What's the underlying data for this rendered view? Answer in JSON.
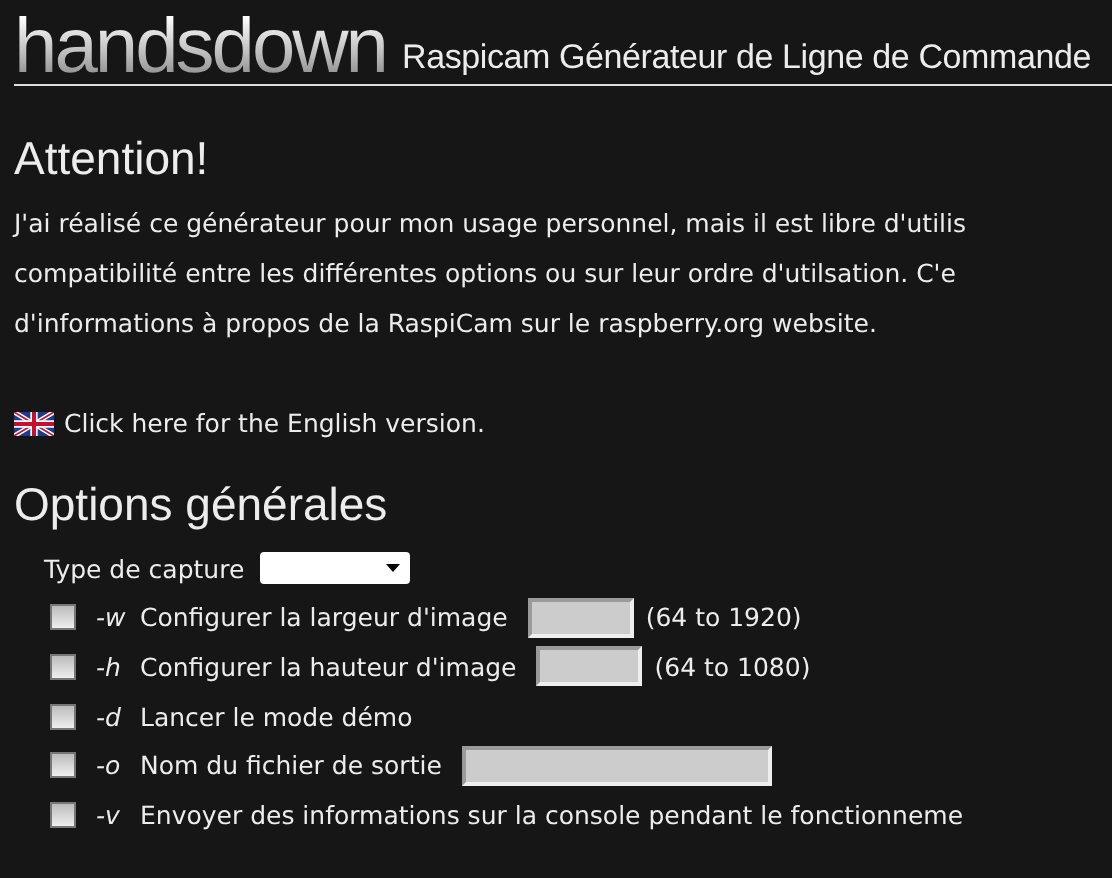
{
  "header": {
    "logo": "handsdown",
    "title": "Raspicam Générateur de Ligne de Commande"
  },
  "notice": {
    "heading": "Attention!",
    "lines": [
      "J'ai réalisé ce générateur pour mon usage personnel, mais il est libre d'utilis",
      "compatibilité entre les différentes options ou sur leur ordre d'utilsation. C'e",
      "d'informations à propos de la RaspiCam sur le raspberry.org website."
    ],
    "english_link": "Click here for the English version."
  },
  "options": {
    "heading": "Options générales",
    "rows": [
      {
        "kind": "select",
        "label": "Type de capture"
      },
      {
        "kind": "checkbox",
        "checked": false,
        "flag": "-w",
        "label": "Configurer la largeur d'image",
        "field": true,
        "wide": false,
        "hint": "(64 to 1920)"
      },
      {
        "kind": "checkbox",
        "checked": false,
        "flag": "-h",
        "label": "Configurer la hauteur d'image",
        "field": true,
        "wide": false,
        "hint": "(64 to 1080)"
      },
      {
        "kind": "checkbox",
        "checked": false,
        "flag": "-d",
        "label": "Lancer le mode démo"
      },
      {
        "kind": "checkbox",
        "checked": false,
        "flag": "-o",
        "label": "Nom du fichier de sortie",
        "field": true,
        "wide": true
      },
      {
        "kind": "checkbox",
        "checked": false,
        "flag": "-v",
        "label": "Envoyer des informations sur la console pendant le fonctionneme"
      }
    ]
  }
}
